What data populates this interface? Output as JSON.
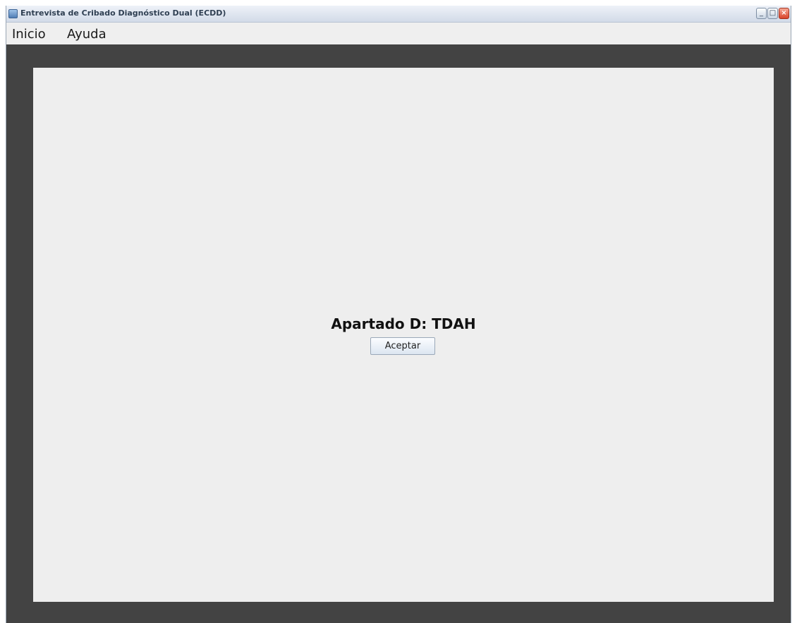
{
  "window": {
    "title": "Entrevista de Cribado Diagnóstico Dual (ECDD)",
    "controls": {
      "minimize": "_",
      "maximize": "□",
      "close": "×"
    }
  },
  "menubar": {
    "items": [
      {
        "label": "Inicio"
      },
      {
        "label": "Ayuda"
      }
    ]
  },
  "main": {
    "section_title": "Apartado D: TDAH",
    "accept_label": "Aceptar"
  },
  "colors": {
    "frame_background": "#434343",
    "panel_background": "#eeeeee",
    "menu_background": "#efefef"
  },
  "icons": {
    "app": "app-window-icon"
  }
}
